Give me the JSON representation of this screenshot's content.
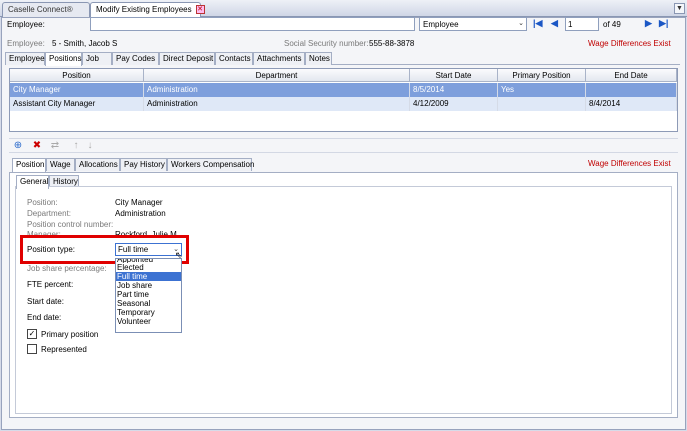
{
  "doc_tabs": [
    {
      "label": "Caselle Connect®"
    },
    {
      "label": "Modify Existing Employees"
    }
  ],
  "header": {
    "employee_label": "Employee:",
    "employee_value": "",
    "search_type": "Employee",
    "record_number": "1",
    "record_total": "of 49"
  },
  "info": {
    "employee_label": "Employee:",
    "employee_value": "5 - Smith, Jacob S",
    "ssn_label": "Social Security number:",
    "ssn_value": "555-88-3878",
    "warning": "Wage Differences Exist"
  },
  "main_tabs": [
    "Employee",
    "Positions",
    "Job",
    "Pay Codes",
    "Direct Deposit",
    "Contacts",
    "Attachments",
    "Notes"
  ],
  "grid": {
    "columns": [
      "Position",
      "Department",
      "Start Date",
      "Primary Position",
      "End Date"
    ],
    "rows": [
      {
        "position": "City Manager",
        "department": "Administration",
        "start": "8/5/2014",
        "primary": "Yes",
        "end": ""
      },
      {
        "position": "Assistant City Manager",
        "department": "Administration",
        "start": "4/12/2009",
        "primary": "",
        "end": "8/4/2014"
      }
    ]
  },
  "sub_tabs": [
    "Position",
    "Wage",
    "Allocations",
    "Pay History",
    "Workers Compensation"
  ],
  "sub_warning": "Wage Differences Exist",
  "inner_tabs": [
    "General",
    "History"
  ],
  "general": {
    "position_label": "Position:",
    "position_value": "City Manager",
    "department_label": "Department:",
    "department_value": "Administration",
    "control_label": "Position control number:",
    "manager_label": "Manager:",
    "manager_value": "Rockford, Julie M",
    "type_label": "Position type:",
    "type_value": "Full time",
    "job_share_label": "Job share percentage:",
    "fte_label": "FTE percent:",
    "start_label": "Start date:",
    "end_label": "End date:",
    "primary_label": "Primary position",
    "represented_label": "Represented"
  },
  "dropdown_options": [
    "Appointed",
    "Elected",
    "Full time",
    "Job share",
    "Part time",
    "Seasonal",
    "Temporary",
    "Volunteer"
  ],
  "colors": {
    "accent": "#3c72d2",
    "warning": "#c00000",
    "highlight_box": "#e00000"
  }
}
